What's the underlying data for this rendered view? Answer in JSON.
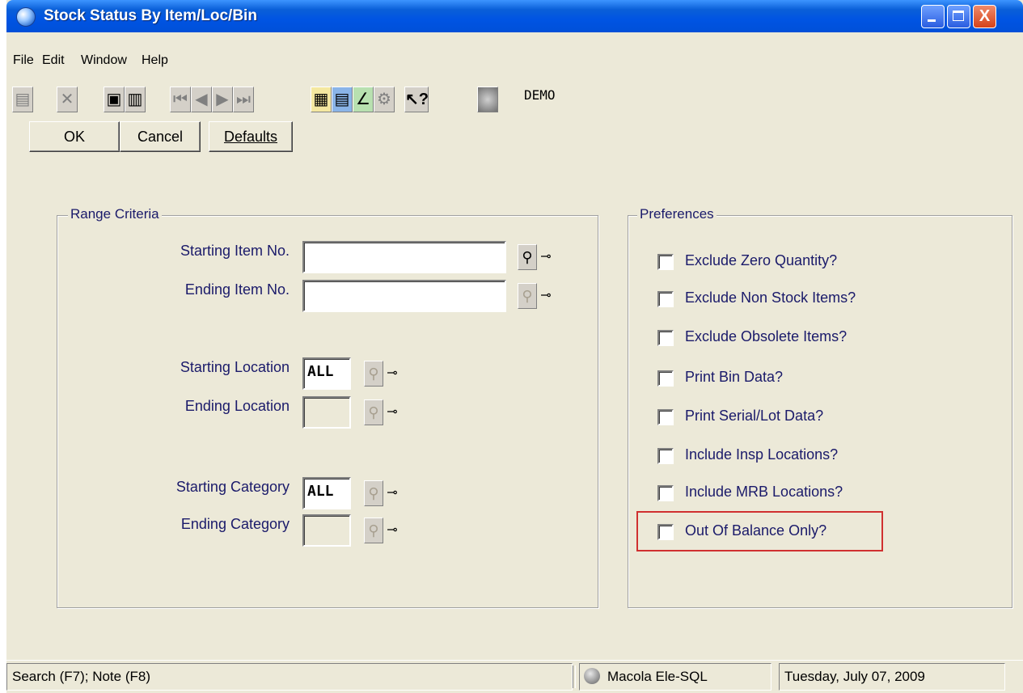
{
  "window": {
    "title": "Stock Status By Item/Loc/Bin",
    "minimize": "",
    "maximize": "",
    "close": "X"
  },
  "menu": [
    "File",
    "Edit",
    "Window",
    "Help"
  ],
  "toolbar": {
    "company": "DEMO"
  },
  "buttons": {
    "ok": "OK",
    "cancel": "Cancel",
    "defaults": "Defaults"
  },
  "range_criteria": {
    "legend": "Range Criteria",
    "starting_item_label": "Starting Item No.",
    "starting_item_value": "",
    "ending_item_label": "Ending Item No.",
    "ending_item_value": "",
    "starting_location_label": "Starting Location",
    "starting_location_value": "ALL",
    "ending_location_label": "Ending Location",
    "ending_location_value": "",
    "starting_category_label": "Starting Category",
    "starting_category_value": "ALL",
    "ending_category_label": "Ending Category",
    "ending_category_value": ""
  },
  "preferences": {
    "legend": "Preferences",
    "items": [
      {
        "label": "Exclude Zero Quantity?",
        "checked": false
      },
      {
        "label": "Exclude Non Stock Items?",
        "checked": false
      },
      {
        "label": "Exclude Obsolete Items?",
        "checked": false
      },
      {
        "label": "Print Bin Data?",
        "checked": false
      },
      {
        "label": "Print Serial/Lot Data?",
        "checked": false
      },
      {
        "label": "Include Insp Locations?",
        "checked": false
      },
      {
        "label": "Include MRB Locations?",
        "checked": false
      },
      {
        "label": "Out Of Balance Only?",
        "checked": false
      }
    ]
  },
  "statusbar": {
    "hint": "Search (F7); Note (F8)",
    "database": "Macola Ele-SQL",
    "date": "Tuesday, July 07, 2009"
  }
}
